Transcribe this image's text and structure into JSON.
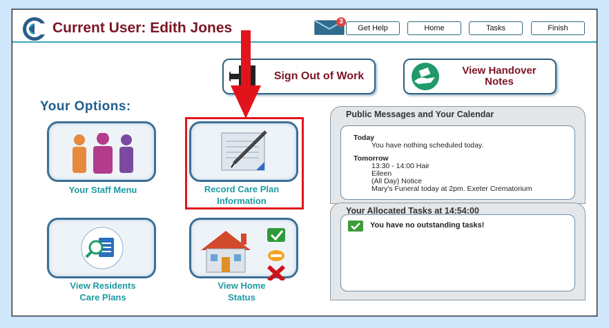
{
  "header": {
    "title": "Current User: Edith Jones",
    "mail_badge": "3",
    "nav": [
      "Get Help",
      "Home",
      "Tasks",
      "Finish"
    ]
  },
  "actions": {
    "sign_out": "Sign Out of Work",
    "handover_line1": "View Handover",
    "handover_line2": "Notes"
  },
  "options": {
    "heading": "Your Options:",
    "tiles": [
      {
        "line1": "Your Staff Menu",
        "line2": ""
      },
      {
        "line1": "Record Care Plan",
        "line2": "Information"
      },
      {
        "line1": "View Residents",
        "line2": "Care Plans"
      },
      {
        "line1": "View Home",
        "line2": "Status"
      }
    ]
  },
  "messages": {
    "title": "Public Messages and Your Calendar",
    "today_label": "Today",
    "today_text": "You have nothing scheduled today.",
    "tomorrow_label": "Tomorrow",
    "tomorrow_lines": [
      "13:30 - 14:00 Hair",
      "Eileen",
      "(All Day) Notice",
      "Mary's Funeral today  at 2pm. Exeter Crematorium"
    ]
  },
  "tasks": {
    "title": "Your Allocated Tasks at 14:54:00",
    "status": "You have no outstanding tasks!"
  },
  "colors": {
    "title": "#7c1424",
    "accent_teal": "#1c9aa3",
    "highlight": "#e2141b",
    "heading_blue": "#1f5d8c"
  }
}
